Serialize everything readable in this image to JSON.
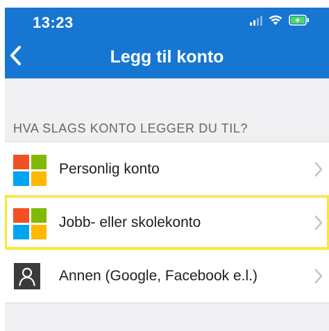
{
  "status_bar": {
    "time": "13:23",
    "icons": [
      "signal-icon",
      "wifi-icon",
      "battery-charging-icon"
    ],
    "battery_color": "#4cd964"
  },
  "nav": {
    "back_icon": "chevron-left-icon",
    "title": "Legg til konto",
    "background": "#1676d2"
  },
  "section": {
    "header": "HVA SLAGS KONTO LEGGER DU TIL?"
  },
  "accounts": [
    {
      "label": "Personlig konto",
      "icon": "microsoft-logo-icon"
    },
    {
      "label": "Jobb- eller skolekonto",
      "icon": "microsoft-logo-icon",
      "highlighted": true,
      "highlight_color": "#fbe834"
    },
    {
      "label": "Annen (Google, Facebook e.l.)",
      "icon": "person-icon"
    }
  ]
}
